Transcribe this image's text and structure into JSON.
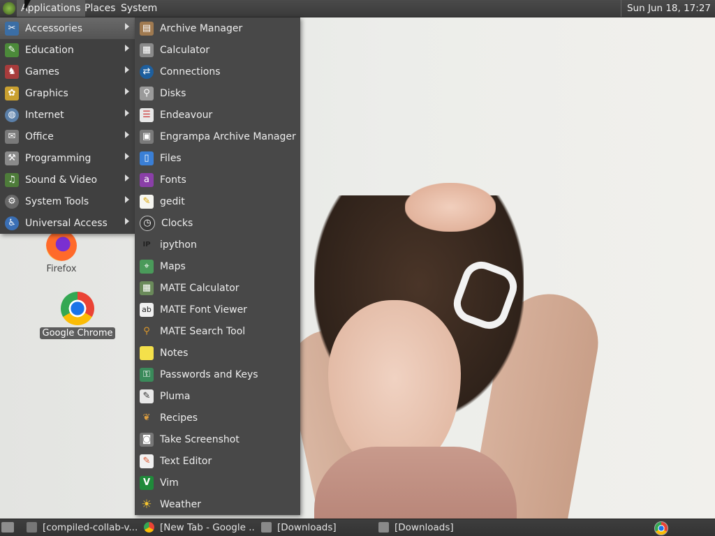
{
  "top_panel": {
    "menus": [
      "Applications",
      "Places",
      "System"
    ],
    "clock": "Sun Jun 18, 17:27"
  },
  "categories": [
    {
      "label": "Accessories",
      "icon": "accessories-icon",
      "selected": true
    },
    {
      "label": "Education",
      "icon": "education-icon"
    },
    {
      "label": "Games",
      "icon": "games-icon"
    },
    {
      "label": "Graphics",
      "icon": "graphics-icon"
    },
    {
      "label": "Internet",
      "icon": "internet-icon"
    },
    {
      "label": "Office",
      "icon": "office-icon"
    },
    {
      "label": "Programming",
      "icon": "programming-icon"
    },
    {
      "label": "Sound & Video",
      "icon": "sound-video-icon"
    },
    {
      "label": "System Tools",
      "icon": "system-tools-icon"
    },
    {
      "label": "Universal Access",
      "icon": "universal-access-icon"
    }
  ],
  "accessories": [
    {
      "label": "Archive Manager",
      "icon": "archive-manager-icon"
    },
    {
      "label": "Calculator",
      "icon": "calculator-icon"
    },
    {
      "label": "Connections",
      "icon": "connections-icon"
    },
    {
      "label": "Disks",
      "icon": "disks-icon"
    },
    {
      "label": "Endeavour",
      "icon": "endeavour-icon"
    },
    {
      "label": "Engrampa Archive Manager",
      "icon": "engrampa-icon"
    },
    {
      "label": "Files",
      "icon": "files-icon"
    },
    {
      "label": "Fonts",
      "icon": "fonts-icon"
    },
    {
      "label": "gedit",
      "icon": "gedit-icon"
    },
    {
      "label": "Clocks",
      "icon": "clocks-icon"
    },
    {
      "label": "ipython",
      "icon": "ipython-icon"
    },
    {
      "label": "Maps",
      "icon": "maps-icon"
    },
    {
      "label": "MATE Calculator",
      "icon": "mate-calculator-icon"
    },
    {
      "label": "MATE Font Viewer",
      "icon": "mate-font-viewer-icon"
    },
    {
      "label": "MATE Search Tool",
      "icon": "mate-search-tool-icon"
    },
    {
      "label": "Notes",
      "icon": "notes-icon"
    },
    {
      "label": "Passwords and Keys",
      "icon": "passwords-keys-icon"
    },
    {
      "label": "Pluma",
      "icon": "pluma-icon"
    },
    {
      "label": "Recipes",
      "icon": "recipes-icon"
    },
    {
      "label": "Take Screenshot",
      "icon": "take-screenshot-icon"
    },
    {
      "label": "Text Editor",
      "icon": "text-editor-icon"
    },
    {
      "label": "Vim",
      "icon": "vim-icon"
    },
    {
      "label": "Weather",
      "icon": "weather-icon"
    }
  ],
  "desktop": {
    "firefox_label": "Firefox",
    "chrome_label": "Google Chrome"
  },
  "taskbar": {
    "tasks": [
      "[compiled-collab-v...",
      "[New Tab - Google ...",
      "[Downloads]",
      "[Downloads]"
    ]
  },
  "colors": {
    "panel": "#3a3a3a",
    "menu_bg": "#484848",
    "selected": "#5e5e5e"
  }
}
